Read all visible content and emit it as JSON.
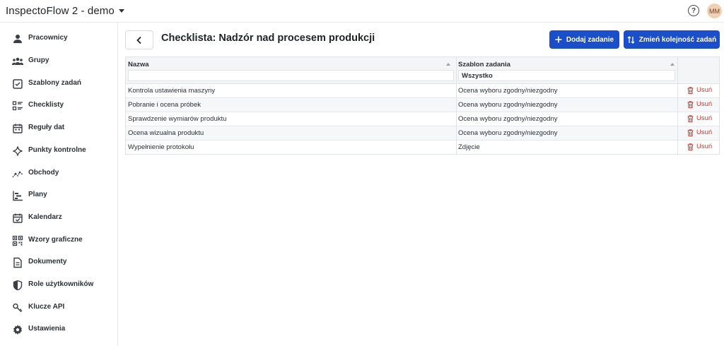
{
  "topbar": {
    "app_title": "InspectoFlow 2 - demo",
    "help_icon": "question-circle-icon",
    "help_glyph": "?",
    "avatar_initials": "MM"
  },
  "sidebar": {
    "items": [
      {
        "label": "Pracownicy",
        "icon": "person-icon"
      },
      {
        "label": "Grupy",
        "icon": "group-icon"
      },
      {
        "label": "Szablony zadań",
        "icon": "checkbox-icon"
      },
      {
        "label": "Checklisty",
        "icon": "checklist-icon"
      },
      {
        "label": "Reguły dat",
        "icon": "calendar-rules-icon"
      },
      {
        "label": "Punkty kontrolne",
        "icon": "sparkle-icon"
      },
      {
        "label": "Obchody",
        "icon": "route-icon"
      },
      {
        "label": "Plany",
        "icon": "plan-icon"
      },
      {
        "label": "Kalendarz",
        "icon": "calendar-check-icon"
      },
      {
        "label": "Wzory graficzne",
        "icon": "qr-code-icon"
      },
      {
        "label": "Dokumenty",
        "icon": "document-icon"
      },
      {
        "label": "Role użytkowników",
        "icon": "shield-icon"
      },
      {
        "label": "Klucze API",
        "icon": "key-icon"
      },
      {
        "label": "Ustawienia",
        "icon": "gear-icon"
      }
    ]
  },
  "page": {
    "title": "Checklista: Nadzór nad procesem produkcji",
    "add_task_label": "Dodaj zadanie",
    "change_order_label": "Zmień kolejność zadań"
  },
  "table": {
    "columns": [
      {
        "header": "Nazwa",
        "filter_value": ""
      },
      {
        "header": "Szablon zadania",
        "filter_value": "Wszystko"
      }
    ],
    "delete_label": "Usuń",
    "rows": [
      {
        "name": "Kontrola ustawienia maszyny",
        "template": "Ocena wyboru zgodny/niezgodny"
      },
      {
        "name": "Pobranie i ocena próbek",
        "template": "Ocena wyboru zgodny/niezgodny"
      },
      {
        "name": "Sprawdzenie wymiarów produktu",
        "template": "Ocena wyboru zgodny/niezgodny"
      },
      {
        "name": "Ocena wizualna produktu",
        "template": "Ocena wyboru zgodny/niezgodny"
      },
      {
        "name": "Wypełnienie protokołu",
        "template": "Zdjęcie"
      }
    ]
  },
  "colors": {
    "primary": "#1b4fc9",
    "danger": "#d9342b",
    "avatar_bg": "#f1d0b1"
  }
}
